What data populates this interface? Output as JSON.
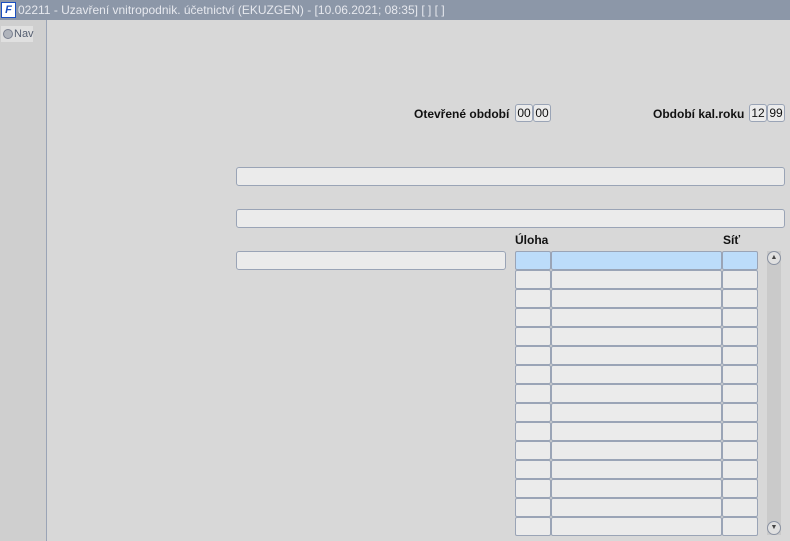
{
  "window": {
    "title": "02211 - Uzavření vnitropodnik. účetnictví (EKUZGEN) - [10.06.2021; 08:35]  [ ]  [ ]",
    "logo": "F"
  },
  "sidebar": {
    "nav_label": "Nav"
  },
  "form": {
    "open_period_label": "Otevřené období",
    "open_period": [
      "00",
      "00"
    ],
    "cal_period_label": "Období kal.roku",
    "cal_period": [
      "12",
      "99"
    ]
  },
  "table": {
    "col_task": "Úloha",
    "col_net": "Síť",
    "rows": 15,
    "selected_row": 0
  },
  "scrollbar": {
    "up": "▲",
    "down": "▼"
  }
}
